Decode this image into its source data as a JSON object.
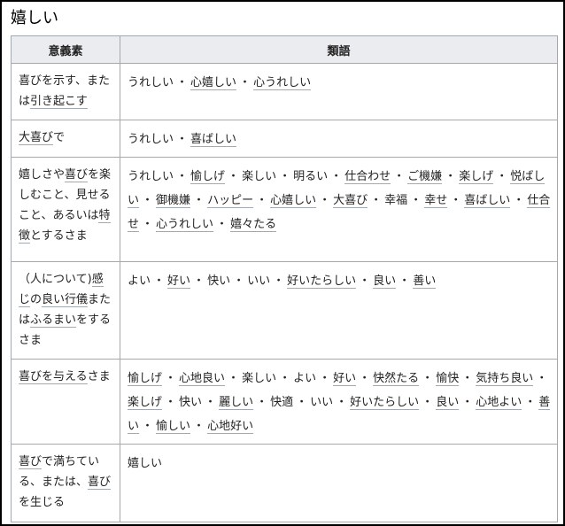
{
  "title": "嬉しい",
  "headers": {
    "meaning": "意義素",
    "synonyms": "類語"
  },
  "rows": [
    {
      "meaning": [
        {
          "t": "喜びを示す、または"
        },
        {
          "t": "引き起こす",
          "link": true
        }
      ],
      "synonyms": [
        {
          "t": "うれしい"
        },
        {
          "t": "心嬉しい",
          "link": true
        },
        {
          "t": "心うれしい",
          "link": true
        }
      ]
    },
    {
      "meaning": [
        {
          "t": "大喜び",
          "link": true
        },
        {
          "t": "で"
        }
      ],
      "synonyms": [
        {
          "t": "うれしい"
        },
        {
          "t": "喜ばしい",
          "link": true
        }
      ]
    },
    {
      "meaning": [
        {
          "t": "嬉しさや"
        },
        {
          "t": "喜び",
          "link": true
        },
        {
          "t": "を楽しむこと、見せること、あるいは"
        },
        {
          "t": "特徴",
          "link": true
        },
        {
          "t": "とするさま"
        }
      ],
      "synonyms": [
        {
          "t": "うれしい"
        },
        {
          "t": "愉しげ",
          "link": true
        },
        {
          "t": "楽しい"
        },
        {
          "t": "明るい"
        },
        {
          "t": "仕合わせ",
          "link": true
        },
        {
          "t": "ご機嫌",
          "link": true
        },
        {
          "t": "楽しげ",
          "link": true
        },
        {
          "t": "悦ばしい",
          "link": true
        },
        {
          "t": "御機嫌",
          "link": true
        },
        {
          "t": "ハッピー",
          "link": true
        },
        {
          "t": "心嬉しい",
          "link": true
        },
        {
          "t": "大喜び",
          "link": true
        },
        {
          "t": "幸福"
        },
        {
          "t": "幸せ",
          "link": true
        },
        {
          "t": "喜ばしい",
          "link": true
        },
        {
          "t": "仕合せ",
          "link": true
        },
        {
          "t": "心うれしい",
          "link": true
        },
        {
          "t": "嬉々たる",
          "link": true
        }
      ]
    },
    {
      "meaning": [
        {
          "t": "（人について)"
        },
        {
          "t": "感じ",
          "link": true
        },
        {
          "t": "の"
        },
        {
          "t": "良い行儀",
          "link": true
        },
        {
          "t": "または"
        },
        {
          "t": "ふるまい",
          "link": true
        },
        {
          "t": "をするさま"
        }
      ],
      "synonyms": [
        {
          "t": "よい"
        },
        {
          "t": "好い",
          "link": true
        },
        {
          "t": "快い"
        },
        {
          "t": "いい"
        },
        {
          "t": "好いたらしい",
          "link": true
        },
        {
          "t": "良い",
          "link": true
        },
        {
          "t": "善い",
          "link": true
        }
      ]
    },
    {
      "meaning": [
        {
          "t": "喜びを与える",
          "link": true
        },
        {
          "t": "さま"
        }
      ],
      "synonyms": [
        {
          "t": "愉しげ",
          "link": true
        },
        {
          "t": "心地良い",
          "link": true
        },
        {
          "t": "楽しい"
        },
        {
          "t": "よい"
        },
        {
          "t": "好い",
          "link": true
        },
        {
          "t": "快然たる",
          "link": true
        },
        {
          "t": "愉快",
          "link": true
        },
        {
          "t": "気持ち良い",
          "link": true
        },
        {
          "t": "楽しげ",
          "link": true
        },
        {
          "t": "快い"
        },
        {
          "t": "麗しい",
          "link": true
        },
        {
          "t": "快適"
        },
        {
          "t": "いい"
        },
        {
          "t": "好いたらしい",
          "link": true
        },
        {
          "t": "良い",
          "link": true
        },
        {
          "t": "心地よい",
          "link": true
        },
        {
          "t": "善い",
          "link": true
        },
        {
          "t": "愉しい",
          "link": true
        },
        {
          "t": "心地好い",
          "link": true
        }
      ]
    },
    {
      "meaning": [
        {
          "t": "喜び",
          "link": true
        },
        {
          "t": "で満ちている、または、"
        },
        {
          "t": "喜び",
          "link": true
        },
        {
          "t": "を生じる"
        }
      ],
      "synonyms": [
        {
          "t": "嬉しい"
        }
      ]
    }
  ],
  "separator": "・",
  "colors": {
    "border": "#a2a9b1",
    "header_bg": "#eaecf0",
    "frame": "#000000"
  }
}
